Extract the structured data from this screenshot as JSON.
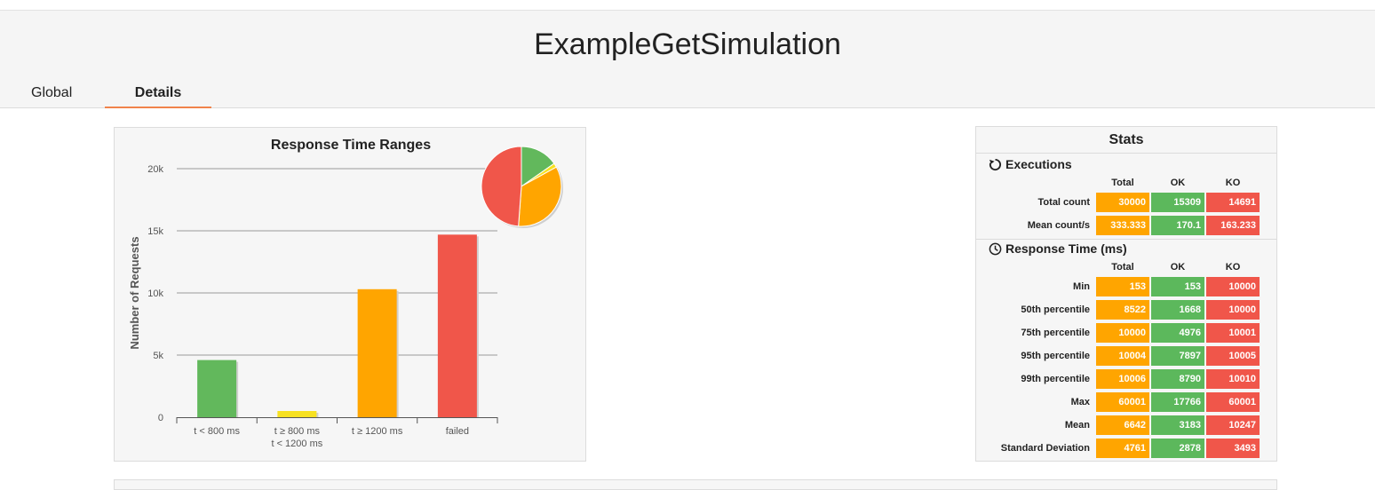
{
  "header": {
    "title": "ExampleGetSimulation",
    "tabs": [
      {
        "label": "Global"
      },
      {
        "label": "Details"
      }
    ]
  },
  "colors": {
    "ok": "#62b85c",
    "warn": "#f7e121",
    "slow": "#ffa500",
    "ko": "#f0564a",
    "tab_accent": "#f0834b"
  },
  "chart_data": {
    "type": "bar",
    "title": "Response Time Ranges",
    "ylabel": "Number of Requests",
    "xlabel": "",
    "categories": [
      "t < 800 ms",
      "t ≥ 800 ms\nt < 1200 ms",
      "t ≥ 1200 ms",
      "failed"
    ],
    "category_lines": [
      [
        "t < 800 ms"
      ],
      [
        "t ≥ 800 ms",
        "t < 1200 ms"
      ],
      [
        "t ≥ 1200 ms"
      ],
      [
        "failed"
      ]
    ],
    "values": [
      4600,
      500,
      10300,
      14691
    ],
    "bar_colors": [
      "#62b85c",
      "#f7e121",
      "#ffa500",
      "#f0564a"
    ],
    "ylim": [
      0,
      20000
    ],
    "yticks": [
      0,
      5000,
      10000,
      15000,
      20000
    ],
    "ytick_labels": [
      "0",
      "5k",
      "10k",
      "15k",
      "20k"
    ],
    "grid": true,
    "pie": {
      "values": [
        4600,
        500,
        10300,
        14691
      ],
      "colors": [
        "#62b85c",
        "#f7e121",
        "#ffa500",
        "#f0564a"
      ]
    }
  },
  "stats": {
    "title": "Stats",
    "executions": {
      "label": "Executions",
      "icon": "refresh-icon",
      "columns": [
        "Total",
        "OK",
        "KO"
      ],
      "rows": [
        {
          "label": "Total count",
          "values": [
            "30000",
            "15309",
            "14691"
          ]
        },
        {
          "label": "Mean count/s",
          "values": [
            "333.333",
            "170.1",
            "163.233"
          ]
        }
      ]
    },
    "response_time": {
      "label": "Response Time (ms)",
      "icon": "clock-icon",
      "columns": [
        "Total",
        "OK",
        "KO"
      ],
      "rows": [
        {
          "label": "Min",
          "values": [
            "153",
            "153",
            "10000"
          ]
        },
        {
          "label": "50th percentile",
          "values": [
            "8522",
            "1668",
            "10000"
          ]
        },
        {
          "label": "75th percentile",
          "values": [
            "10000",
            "4976",
            "10001"
          ]
        },
        {
          "label": "95th percentile",
          "values": [
            "10004",
            "7897",
            "10005"
          ]
        },
        {
          "label": "99th percentile",
          "values": [
            "10006",
            "8790",
            "10010"
          ]
        },
        {
          "label": "Max",
          "values": [
            "60001",
            "17766",
            "60001"
          ]
        },
        {
          "label": "Mean",
          "values": [
            "6642",
            "3183",
            "10247"
          ]
        },
        {
          "label": "Standard Deviation",
          "values": [
            "4761",
            "2878",
            "3493"
          ]
        }
      ]
    }
  }
}
